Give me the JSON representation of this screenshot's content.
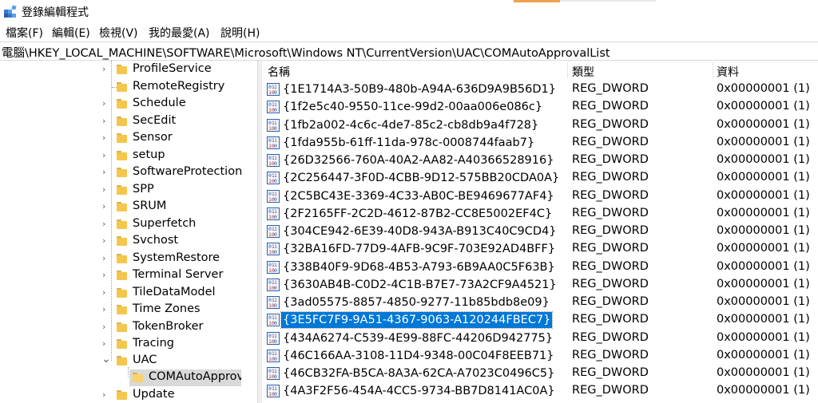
{
  "window": {
    "title": "登錄編輯程式"
  },
  "menu": [
    "檔案(F)",
    "編輯(E)",
    "檢視(V)",
    "我的最愛(A)",
    "說明(H)"
  ],
  "address": "電腦\\HKEY_LOCAL_MACHINE\\SOFTWARE\\Microsoft\\Windows NT\\CurrentVersion\\UAC\\COMAutoApprovalList",
  "tree": {
    "items": [
      {
        "label": "ProfileService",
        "expander": "›"
      },
      {
        "label": "RemoteRegistry",
        "expander": ""
      },
      {
        "label": "Schedule",
        "expander": "›"
      },
      {
        "label": "SecEdit",
        "expander": "›"
      },
      {
        "label": "Sensor",
        "expander": "›"
      },
      {
        "label": "setup",
        "expander": "›"
      },
      {
        "label": "SoftwareProtection",
        "expander": "›"
      },
      {
        "label": "SPP",
        "expander": "›"
      },
      {
        "label": "SRUM",
        "expander": "›"
      },
      {
        "label": "Superfetch",
        "expander": "›"
      },
      {
        "label": "Svchost",
        "expander": "›"
      },
      {
        "label": "SystemRestore",
        "expander": "›"
      },
      {
        "label": "Terminal Server",
        "expander": "›"
      },
      {
        "label": "TileDataModel",
        "expander": "›"
      },
      {
        "label": "Time Zones",
        "expander": "›"
      },
      {
        "label": "TokenBroker",
        "expander": "›"
      },
      {
        "label": "Tracing",
        "expander": "›"
      },
      {
        "label": "UAC",
        "expander": "⌄"
      },
      {
        "label": "COMAutoApprovalList",
        "expander": ""
      },
      {
        "label": "Update",
        "expander": "›"
      }
    ]
  },
  "columns": {
    "name": "名稱",
    "type": "類型",
    "data": "資料"
  },
  "values": [
    {
      "name": "{1E1714A3-50B9-480b-A94A-636D9A9B56D1}",
      "type": "REG_DWORD",
      "data": "0x00000001 (1)"
    },
    {
      "name": "{1f2e5c40-9550-11ce-99d2-00aa006e086c}",
      "type": "REG_DWORD",
      "data": "0x00000001 (1)"
    },
    {
      "name": "{1fb2a002-4c6c-4de7-85c2-cb8db9a4f728}",
      "type": "REG_DWORD",
      "data": "0x00000001 (1)"
    },
    {
      "name": "{1fda955b-61ff-11da-978c-0008744faab7}",
      "type": "REG_DWORD",
      "data": "0x00000001 (1)"
    },
    {
      "name": "{26D32566-760A-40A2-AA82-A40366528916}",
      "type": "REG_DWORD",
      "data": "0x00000001 (1)"
    },
    {
      "name": "{2C256447-3F0D-4CBB-9D12-575BB20CDA0A}",
      "type": "REG_DWORD",
      "data": "0x00000001 (1)"
    },
    {
      "name": "{2C5BC43E-3369-4C33-AB0C-BE9469677AF4}",
      "type": "REG_DWORD",
      "data": "0x00000001 (1)"
    },
    {
      "name": "{2F2165FF-2C2D-4612-87B2-CC8E5002EF4C}",
      "type": "REG_DWORD",
      "data": "0x00000001 (1)"
    },
    {
      "name": "{304CE942-6E39-40D8-943A-B913C40C9CD4}",
      "type": "REG_DWORD",
      "data": "0x00000001 (1)"
    },
    {
      "name": "{32BA16FD-77D9-4AFB-9C9F-703E92AD4BFF}",
      "type": "REG_DWORD",
      "data": "0x00000001 (1)"
    },
    {
      "name": "{338B40F9-9D68-4B53-A793-6B9AA0C5F63B}",
      "type": "REG_DWORD",
      "data": "0x00000001 (1)"
    },
    {
      "name": "{3630AB4B-C0D2-4C1B-B7E7-73A2CF9A4521}",
      "type": "REG_DWORD",
      "data": "0x00000001 (1)"
    },
    {
      "name": "{3ad05575-8857-4850-9277-11b85bdb8e09}",
      "type": "REG_DWORD",
      "data": "0x00000001 (1)"
    },
    {
      "name": "{3E5FC7F9-9A51-4367-9063-A120244FBEC7}",
      "type": "REG_DWORD",
      "data": "0x00000001 (1)",
      "selected": true
    },
    {
      "name": "{434A6274-C539-4E99-88FC-44206D942775}",
      "type": "REG_DWORD",
      "data": "0x00000001 (1)"
    },
    {
      "name": "{46C166AA-3108-11D4-9348-00C04F8EEB71}",
      "type": "REG_DWORD",
      "data": "0x00000001 (1)"
    },
    {
      "name": "{46CB32FA-B5CA-8A3A-62CA-A7023C0496C5}",
      "type": "REG_DWORD",
      "data": "0x00000001 (1)"
    },
    {
      "name": "{4A3F2F56-454A-4CC5-9734-BB7D8141AC0A}",
      "type": "REG_DWORD",
      "data": "0x00000001 (1)"
    }
  ],
  "colors": {
    "selection": "#0078d7",
    "folder": "#f4c64c",
    "regicon": "#2a5db0"
  }
}
